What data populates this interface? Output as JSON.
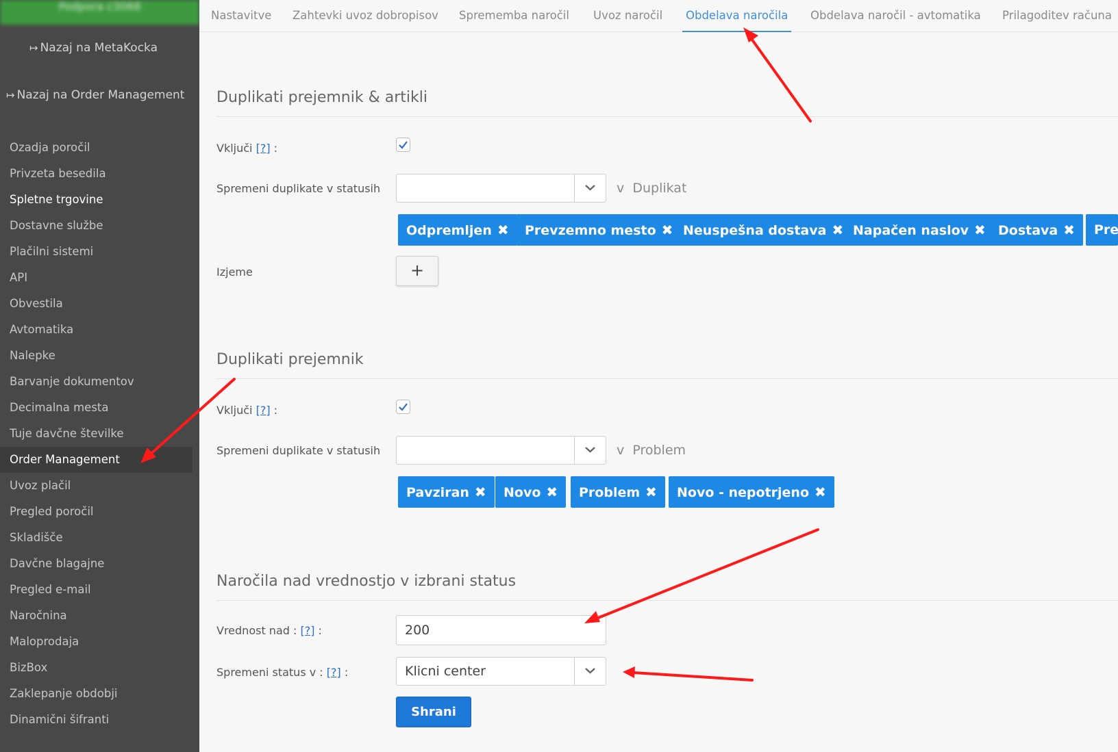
{
  "sidebar": {
    "top_blurred": "Podpora c3068",
    "back_links": [
      "Nazaj na MetaKocka",
      "Nazaj na Order Management"
    ],
    "items": [
      "Ozadja poročil",
      "Privzeta besedila",
      "Spletne trgovine",
      "Dostavne službe",
      "Plačilni sistemi",
      "API",
      "Obvestila",
      "Avtomatika",
      "Nalepke",
      "Barvanje dokumentov",
      "Decimalna mesta",
      "Tuje davčne številke",
      "Order Management",
      "Uvoz plačil",
      "Pregled poročil",
      "Skladišče",
      "Davčne blagajne",
      "Pregled e-mail",
      "Naročnina",
      "Maloprodaja",
      "BizBox",
      "Zaklepanje obdobji",
      "Dinamični šifranti"
    ],
    "active_item": "Order Management"
  },
  "tabs": [
    "Nastavitve",
    "Zahtevki uvoz dobropisov",
    "Sprememba naročil",
    "Uvoz naročil",
    "Obdelava naročila",
    "Obdelava naročil - avtomatika",
    "Prilagoditev računa"
  ],
  "active_tab": "Obdelava naročila",
  "section1": {
    "title": "Duplikati prejemnik & artikli",
    "enable_label": "Vključi",
    "help": "[?]",
    "colon": ":",
    "change_label": "Spremeni duplikate v statusih",
    "select_value": "",
    "after_prefix": "v",
    "after_value": "Duplikat",
    "tags": [
      "Odpremljen",
      "Prevzemno mesto",
      "Neuspešna dostava",
      "Napačen naslov",
      "Dostava",
      "Pre"
    ],
    "exceptions_label": "Izjeme",
    "plus": "+"
  },
  "section2": {
    "title": "Duplikati prejemnik",
    "enable_label": "Vključi",
    "help": "[?]",
    "colon": ":",
    "change_label": "Spremeni duplikate v statusih",
    "select_value": "",
    "after_prefix": "v",
    "after_value": "Problem",
    "tags": [
      "Pavziran",
      "Novo",
      "Problem",
      "Novo - nepotrjeno"
    ]
  },
  "section3": {
    "title": "Naročila nad vrednostjo v izbrani status",
    "value_label": "Vrednost nad :",
    "help": "[?]",
    "colon": ":",
    "value": "200",
    "status_label": "Spremeni status v :",
    "status_value": "Klicni center",
    "save": "Shrani"
  },
  "colors": {
    "sidebar_bg": "#484848",
    "sidebar_top": "#3e9a3f",
    "tag_bg": "#1e88e5",
    "tab_active": "#3f8fd8",
    "save_bg": "#1e78d8",
    "annotation_arrow": "#ff1a1a"
  },
  "icons": [
    "sign-out-icon",
    "check-icon",
    "chevron-down-icon",
    "close-icon",
    "plus-icon"
  ]
}
